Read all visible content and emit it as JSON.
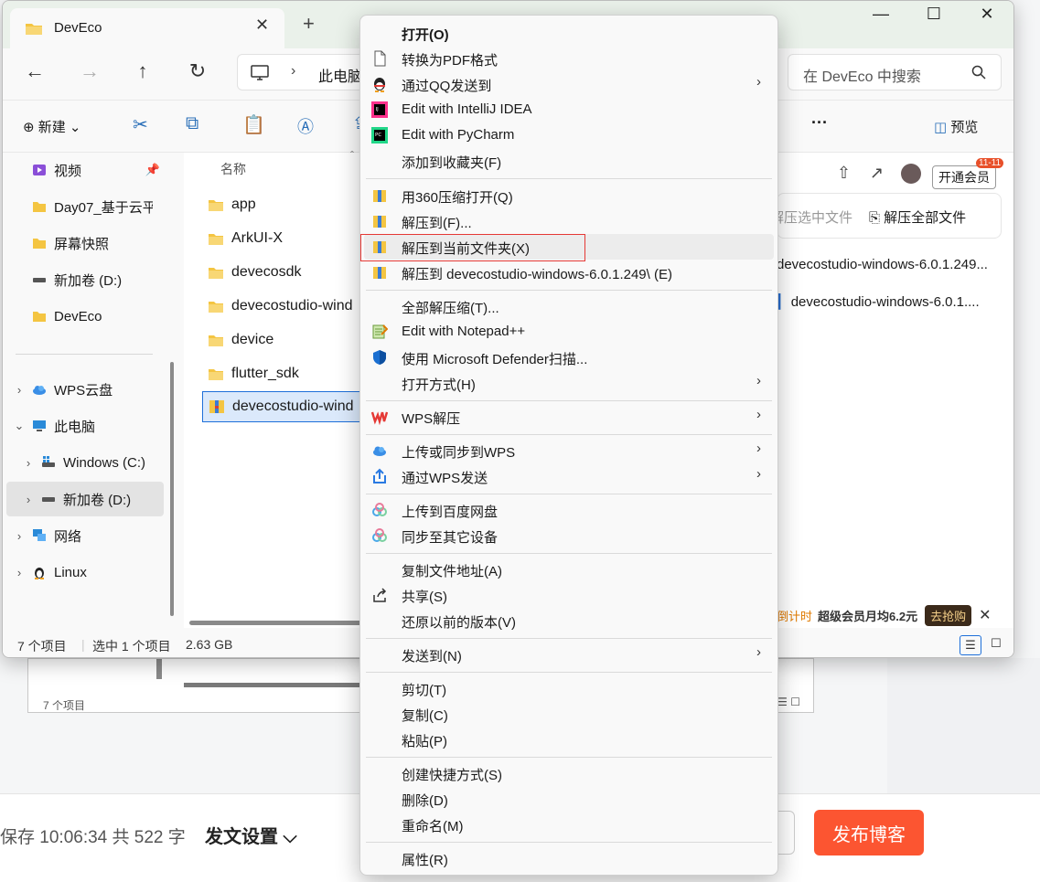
{
  "background": {
    "ghost_status": "7 个项目",
    "save_text": "保存 10:06:34 共 522 字",
    "publish_settings": "发文设置",
    "publish_button": "发布博客"
  },
  "explorer": {
    "tab_title": "DevEco",
    "address_crumb": "此电脑",
    "search_placeholder": "在 DevEco 中搜索",
    "toolbar": {
      "new_label": "新建",
      "preview_label": "预览"
    },
    "sidebar": {
      "videos": "视频",
      "day07": "Day07_基于云平",
      "screenshots": "屏幕快照",
      "drive_d_quick": "新加卷 (D:)",
      "deveco": "DevEco",
      "wps_cloud": "WPS云盘",
      "this_pc": "此电脑",
      "windows_c": "Windows (C:)",
      "drive_d": "新加卷 (D:)",
      "network": "网络",
      "linux": "Linux"
    },
    "column_name": "名称",
    "files": [
      "app",
      "ArkUI-X",
      "devecosdk",
      "devecostudio-wind",
      "device",
      "flutter_sdk",
      "devecostudio-wind"
    ],
    "wps_panel": {
      "member_button": "开通会员",
      "member_badge": "11-11",
      "extract_selected": "解压选中文件",
      "extract_all": "解压全部文件",
      "file_line_1": "devecostudio-windows-6.0.1.249...",
      "file_line_2": "devecostudio-windows-6.0.1....",
      "promo_countdown": "倒计时",
      "promo_text": "超级会员月均6.2元",
      "promo_button": "去抢购"
    },
    "status": {
      "item_count": "7 个项目",
      "selected": "选中 1 个项目",
      "size": "2.63 GB"
    }
  },
  "context_menu": {
    "open": "打开(O)",
    "to_pdf": "转换为PDF格式",
    "send_qq": "通过QQ发送到",
    "intellij": "Edit with IntelliJ IDEA",
    "pycharm": "Edit with PyCharm",
    "add_fav": "添加到收藏夹(F)",
    "open_360": "用360压缩打开(Q)",
    "extract_to": "解压到(F)...",
    "extract_here": "解压到当前文件夹(X)",
    "extract_named": "解压到 devecostudio-windows-6.0.1.249\\ (E)",
    "extract_all": "全部解压缩(T)...",
    "notepad": "Edit with Notepad++",
    "defender": "使用 Microsoft Defender扫描...",
    "open_with": "打开方式(H)",
    "wps_extract": "WPS解压",
    "upload_wps": "上传或同步到WPS",
    "send_wps": "通过WPS发送",
    "baidu_upload": "上传到百度网盘",
    "sync_devices": "同步至其它设备",
    "copy_path": "复制文件地址(A)",
    "share": "共享(S)",
    "restore": "还原以前的版本(V)",
    "send_to": "发送到(N)",
    "cut": "剪切(T)",
    "copy": "复制(C)",
    "paste": "粘贴(P)",
    "shortcut": "创建快捷方式(S)",
    "delete": "删除(D)",
    "rename": "重命名(M)",
    "properties": "属性(R)"
  },
  "colors": {
    "folder": "#f4c542",
    "accent_blue": "#1e6fd9",
    "publish_red": "#fc5531",
    "highlight_red": "#e53935"
  }
}
